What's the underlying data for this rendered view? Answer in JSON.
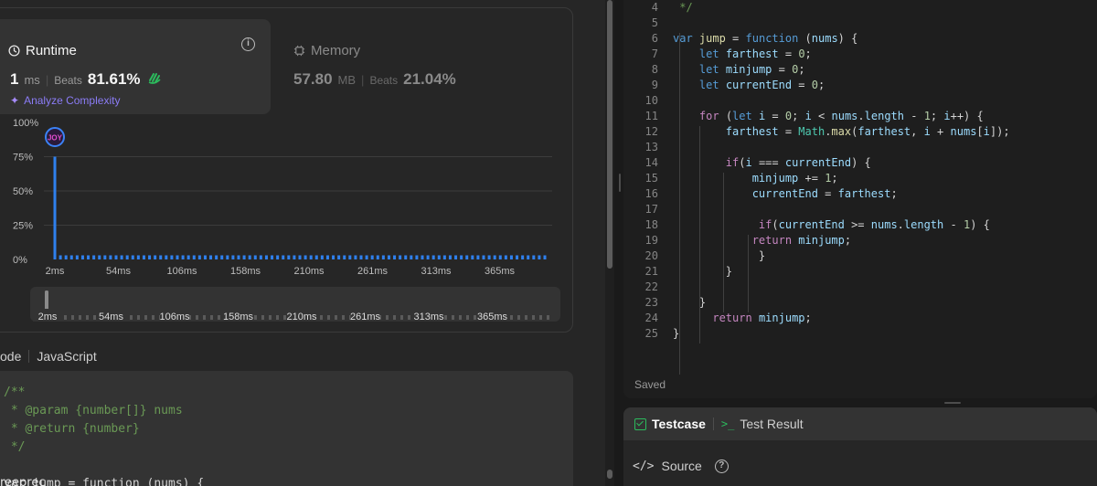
{
  "runtime": {
    "title": "Runtime",
    "value": "1",
    "unit": "ms",
    "beats_label": "Beats",
    "beats_pct": "81.61%",
    "analyze": "Analyze Complexity"
  },
  "memory": {
    "title": "Memory",
    "value": "57.80",
    "unit": "MB",
    "beats_label": "Beats",
    "beats_pct": "21.04%"
  },
  "colors": {
    "bar": "#2f80ed",
    "accent_green": "#2cbb5d",
    "analyze_purple": "#8b7cf6"
  },
  "chart_data": {
    "type": "bar",
    "title": "",
    "xlabel": "",
    "ylabel": "",
    "ylim": [
      0,
      100
    ],
    "y_ticks": [
      "100%",
      "75%",
      "50%",
      "25%",
      "0%"
    ],
    "x_ticks": [
      "2ms",
      "54ms",
      "106ms",
      "158ms",
      "210ms",
      "261ms",
      "313ms",
      "365ms"
    ],
    "series": [
      {
        "values": [
          75,
          3,
          3,
          3,
          3,
          3,
          3,
          3,
          3,
          3,
          3,
          3,
          3,
          3,
          3,
          3,
          3,
          3,
          3,
          3,
          3,
          3,
          3,
          3,
          3,
          3,
          3,
          3,
          3,
          3,
          3,
          3,
          3,
          3,
          3,
          3,
          3,
          3,
          3,
          3,
          3,
          3,
          3,
          3,
          3,
          3,
          3,
          3,
          3,
          3,
          3,
          3,
          3,
          3,
          3,
          3,
          3,
          3,
          3,
          3,
          3,
          3,
          3,
          3,
          3,
          3,
          3,
          3,
          3,
          3,
          3,
          3,
          3,
          3,
          3,
          3,
          3,
          3,
          3,
          3,
          3,
          3,
          3,
          3,
          3,
          3,
          3,
          3,
          3
        ]
      }
    ],
    "marker_label": "JOY",
    "minimap_ticks": [
      "2ms",
      "54ms",
      "106ms",
      "158ms",
      "210ms",
      "261ms",
      "313ms",
      "365ms"
    ]
  },
  "lang": {
    "prefix": "ode",
    "name": "JavaScript"
  },
  "bottom_code_lines": [
    "/**",
    " * @param {number[]} nums",
    " * @return {number}",
    " */",
    "",
    "var jump = function (nums) {"
  ],
  "freerec": "reeprec",
  "editor": {
    "lines": [
      {
        "n": "4",
        "t": " */"
      },
      {
        "n": "5",
        "t": ""
      },
      {
        "n": "6",
        "t": "var jump = function (nums) {"
      },
      {
        "n": "7",
        "t": "    let farthest = 0;"
      },
      {
        "n": "8",
        "t": "    let minjump = 0;"
      },
      {
        "n": "9",
        "t": "    let currentEnd = 0;"
      },
      {
        "n": "10",
        "t": ""
      },
      {
        "n": "11",
        "t": "    for (let i = 0; i < nums.length - 1; i++) {"
      },
      {
        "n": "12",
        "t": "        farthest = Math.max(farthest, i + nums[i]);"
      },
      {
        "n": "13",
        "t": ""
      },
      {
        "n": "14",
        "t": "        if(i === currentEnd) {"
      },
      {
        "n": "15",
        "t": "            minjump += 1;"
      },
      {
        "n": "16",
        "t": "            currentEnd = farthest;"
      },
      {
        "n": "17",
        "t": ""
      },
      {
        "n": "18",
        "t": "             if(currentEnd >= nums.length - 1) {"
      },
      {
        "n": "19",
        "t": "            return minjump;"
      },
      {
        "n": "20",
        "t": "             }"
      },
      {
        "n": "21",
        "t": "        }"
      },
      {
        "n": "22",
        "t": ""
      },
      {
        "n": "23",
        "t": "    }"
      },
      {
        "n": "24",
        "t": "      return minjump;"
      },
      {
        "n": "25",
        "t": "}"
      }
    ],
    "status": "Saved"
  },
  "panel": {
    "testcase": "Testcase",
    "test_result": "Test Result",
    "source": "Source"
  }
}
